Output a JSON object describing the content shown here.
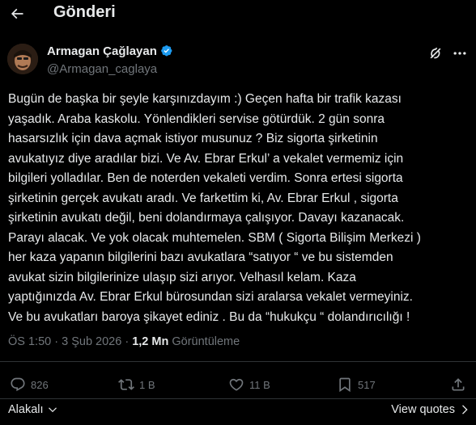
{
  "colors": {
    "background": "#000000",
    "text_primary": "#e7e9ea",
    "text_secondary": "#71767b",
    "verified_badge": "#1d9bf0",
    "divider": "#2f3336"
  },
  "header": {
    "back_icon": "arrow-left-icon",
    "title": "Gönderi"
  },
  "author": {
    "name": "Armagan Çağlayan",
    "handle": "@Armagan_caglaya",
    "verified_icon": "verified-badge-icon"
  },
  "tweet": {
    "lines": [
      "Bugün de başka bir şeyle karşınızdayım :) Geçen hafta bir trafik kazası",
      "yaşadık. Araba kaskolu. Yönlendikleri servise götürdük. 2 gün sonra",
      "hasarsızlık için dava açmak istiyor musunuz ? Biz sigorta şirketinin",
      "avukatıyız diye aradılar bizi. Ve Av. Ebrar Erkul’ a vekalet vermemiz için",
      "bilgileri yolladılar. Ben de noterden vekaleti verdim. Sonra ertesi sigorta",
      "şirketinin gerçek avukatı aradı. Ve farkettim ki, Av. Ebrar Erkul , sigorta",
      "şirketinin avukatı değil, beni dolandırmaya çalışıyor. Davayı kazanacak.",
      "Parayı alacak. Ve yok olacak muhtemelen. SBM ( Sigorta Bilişim Merkezi )",
      "her kaza yapanın bilgilerini bazı avukatlara “satıyor “ ve bu sistemden",
      "avukat sizin bilgilerinize ulaşıp sizi arıyor. Velhasıl kelam. Kaza",
      "yaptığınızda Av. Ebrar Erkul bürosundan sizi aralarsa vekalet vermeyiniz.",
      "Ve bu avukatları baroya şikayet ediniz . Bu da “hukukçu “ dolandırıcılığı !"
    ],
    "time": "ÖS 1:50",
    "date": "3 Şub 2026",
    "separator": "·",
    "views_count": "1,2 Mn",
    "views_label": "Görüntüleme"
  },
  "actions": {
    "reply_count": "826",
    "repost_count": "1 B",
    "like_count": "11 B",
    "bookmark_count": "517"
  },
  "footer": {
    "sort_label": "Alakalı",
    "view_quotes_label": "View quotes"
  }
}
